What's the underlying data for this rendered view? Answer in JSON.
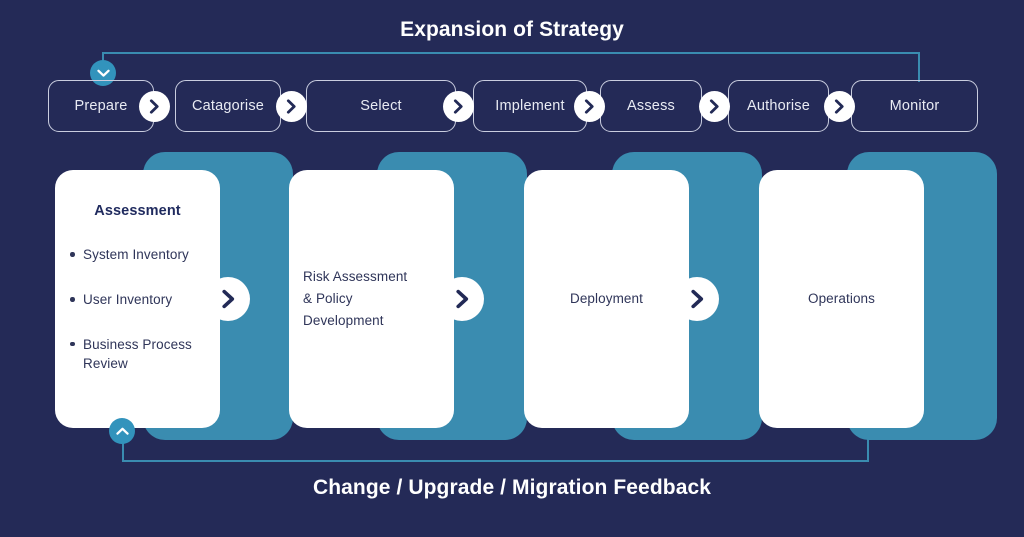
{
  "theme": {
    "background": "#242a57",
    "teal": "#3a8cb0",
    "marker_teal": "#3293bc",
    "card_face": "#ffffff",
    "text_navy": "#2f3559",
    "heading_navy": "#1f2a5e",
    "pill_border": "#c9cddf",
    "pill_text": "#e9ebf3"
  },
  "title_top": "Expansion of Strategy",
  "title_bottom": "Change / Upgrade / Migration Feedback",
  "pipeline": {
    "steps": [
      {
        "label": "Prepare"
      },
      {
        "label": "Catagorise"
      },
      {
        "label": "Select"
      },
      {
        "label": "Implement"
      },
      {
        "label": "Assess"
      },
      {
        "label": "Authorise"
      },
      {
        "label": "Monitor"
      }
    ],
    "separator_icon": "chevron-right-icon"
  },
  "markers": {
    "top": {
      "icon": "chevron-down-icon"
    },
    "bottom": {
      "icon": "chevron-up-icon"
    }
  },
  "phases": [
    {
      "id": "assessment",
      "title": "Assessment",
      "items": [
        "System Inventory",
        "User Inventory",
        "Business Process Review"
      ],
      "has_arrow": true,
      "arrow_icon": "chevron-right-icon"
    },
    {
      "id": "risk-policy",
      "lines": [
        "Risk Assessment",
        "& Policy",
        "Development"
      ],
      "has_arrow": true,
      "arrow_icon": "chevron-right-icon"
    },
    {
      "id": "deployment",
      "lines": [
        "Deployment"
      ],
      "has_arrow": true,
      "arrow_icon": "chevron-right-icon"
    },
    {
      "id": "operations",
      "lines": [
        "Operations"
      ],
      "has_arrow": false
    }
  ]
}
